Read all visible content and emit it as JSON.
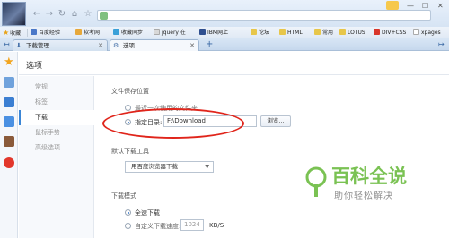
{
  "toolbar": {
    "back": "←",
    "forward": "→",
    "reload": "↻",
    "home": "⌂",
    "bookmark_star": "☆",
    "minimize": "—",
    "maximize": "☐",
    "close": "✕"
  },
  "bookmarks": {
    "favorites_label": "收藏",
    "items": [
      "百度经验",
      "软考网",
      "收藏同步",
      "jquery 在",
      "IBM网上",
      "论坛",
      "HTML",
      "常用",
      "LOTUS",
      "DIV+CSS",
      "xpages"
    ]
  },
  "tabs": [
    {
      "label": "下载管理",
      "icon": "download-icon",
      "active": false
    },
    {
      "label": "选项",
      "icon": "gear-icon",
      "active": true
    }
  ],
  "tab_new": "+",
  "page": {
    "title": "选项"
  },
  "sidenav": {
    "items": [
      "常规",
      "标签",
      "下载",
      "鼠标手势",
      "高级选项"
    ],
    "selected_index": 2
  },
  "save_location": {
    "heading": "文件保存位置",
    "option_last": "最近一次使用的文件夹",
    "option_fixed": "指定目录:",
    "path_value": "F:\\Download",
    "browse_label": "浏览..."
  },
  "download_tool": {
    "heading": "默认下载工具",
    "selected": "用百度浏览器下载"
  },
  "download_mode": {
    "heading": "下载模式",
    "option_full": "全速下载",
    "option_custom": "自定义下载速度:",
    "speed_value": "1024",
    "speed_unit": "KB/S"
  },
  "watermark": {
    "title": "百科全说",
    "subtitle": "助你轻松解决"
  },
  "colors": {
    "accent": "#3b86d6",
    "highlight_ellipse": "#e0251b",
    "watermark_green": "#7ac253"
  }
}
